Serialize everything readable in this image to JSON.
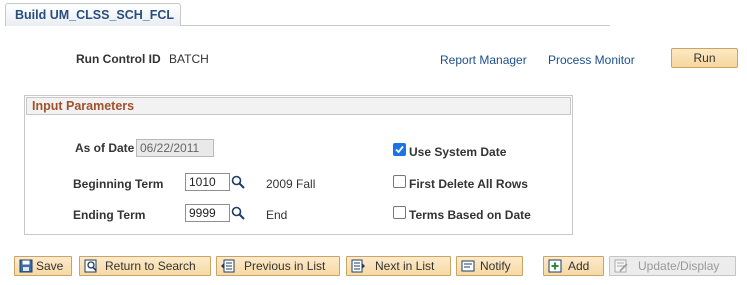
{
  "tab": {
    "label": "Build UM_CLSS_SCH_FCL"
  },
  "run_control": {
    "label": "Run Control ID",
    "value": "BATCH"
  },
  "links": {
    "report_manager": "Report Manager",
    "process_monitor": "Process Monitor"
  },
  "run_button": "Run",
  "input_parameters": {
    "title": "Input Parameters",
    "as_of_date": {
      "label": "As of Date",
      "value": "06/22/2011"
    },
    "beginning_term": {
      "label": "Beginning Term",
      "value": "1010",
      "description": "2009 Fall"
    },
    "ending_term": {
      "label": "Ending Term",
      "value": "9999",
      "description": "End"
    },
    "use_system_date": {
      "label": "Use System Date",
      "checked": true
    },
    "first_delete_all_rows": {
      "label": "First Delete All Rows",
      "checked": false
    },
    "terms_based_on_date": {
      "label": "Terms Based on Date",
      "checked": false
    }
  },
  "toolbar": {
    "save": "Save",
    "return_to_search": "Return to Search",
    "previous_in_list": "Previous in List",
    "next_in_list": "Next in List",
    "notify": "Notify",
    "add": "Add",
    "update_display": "Update/Display"
  },
  "colors": {
    "tab_text": "#2a4d7e",
    "group_title": "#a1512b",
    "link": "#1d4f8b",
    "button_fill": "#f6d79c",
    "checkbox_checked": "#1a73e8"
  },
  "icons": [
    "search-icon",
    "save-icon",
    "return-to-search-icon",
    "previous-in-list-icon",
    "next-in-list-icon",
    "notify-icon",
    "add-icon",
    "update-display-icon"
  ]
}
